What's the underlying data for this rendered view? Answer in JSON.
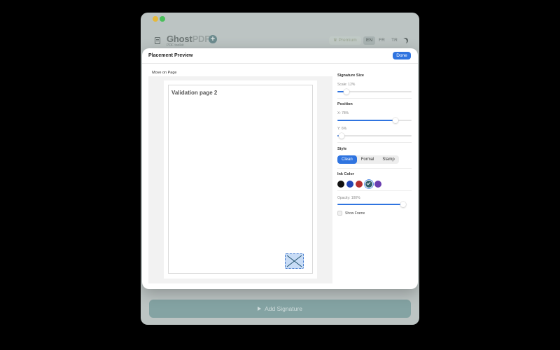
{
  "app": {
    "title_main": "Ghost",
    "title_pdf": "PDF",
    "subtitle": "PDF toolkit",
    "premium_label": "Premium",
    "languages": [
      "EN",
      "FR",
      "TR"
    ],
    "active_language": "EN",
    "add_signature_label": "Add Signature"
  },
  "modal": {
    "title": "Placement Preview",
    "done_label": "Done",
    "move_label": "Move on Page",
    "page_title": "Validation page 2"
  },
  "panel": {
    "signature_size": {
      "title": "Signature Size",
      "scale_label": "Scale: 12%",
      "scale_value": 0.12
    },
    "position": {
      "title": "Position",
      "x_label": "X: 78%",
      "x_value": 0.78,
      "y_label": "Y: 6%",
      "y_value": 0.06
    },
    "style": {
      "title": "Style",
      "options": [
        "Clean",
        "Formal",
        "Stamp"
      ],
      "selected": "Clean"
    },
    "ink_color": {
      "title": "Ink Color",
      "colors": [
        "#111111",
        "#2346b5",
        "#b53030",
        "#2e5f68",
        "#6a3fb0"
      ],
      "selected_index": 3,
      "opacity_label": "Opacity: 100%",
      "opacity_value": 1.0
    },
    "show_frame_label": "Show Frame"
  },
  "colors": {
    "accent": "#2f74e0"
  }
}
